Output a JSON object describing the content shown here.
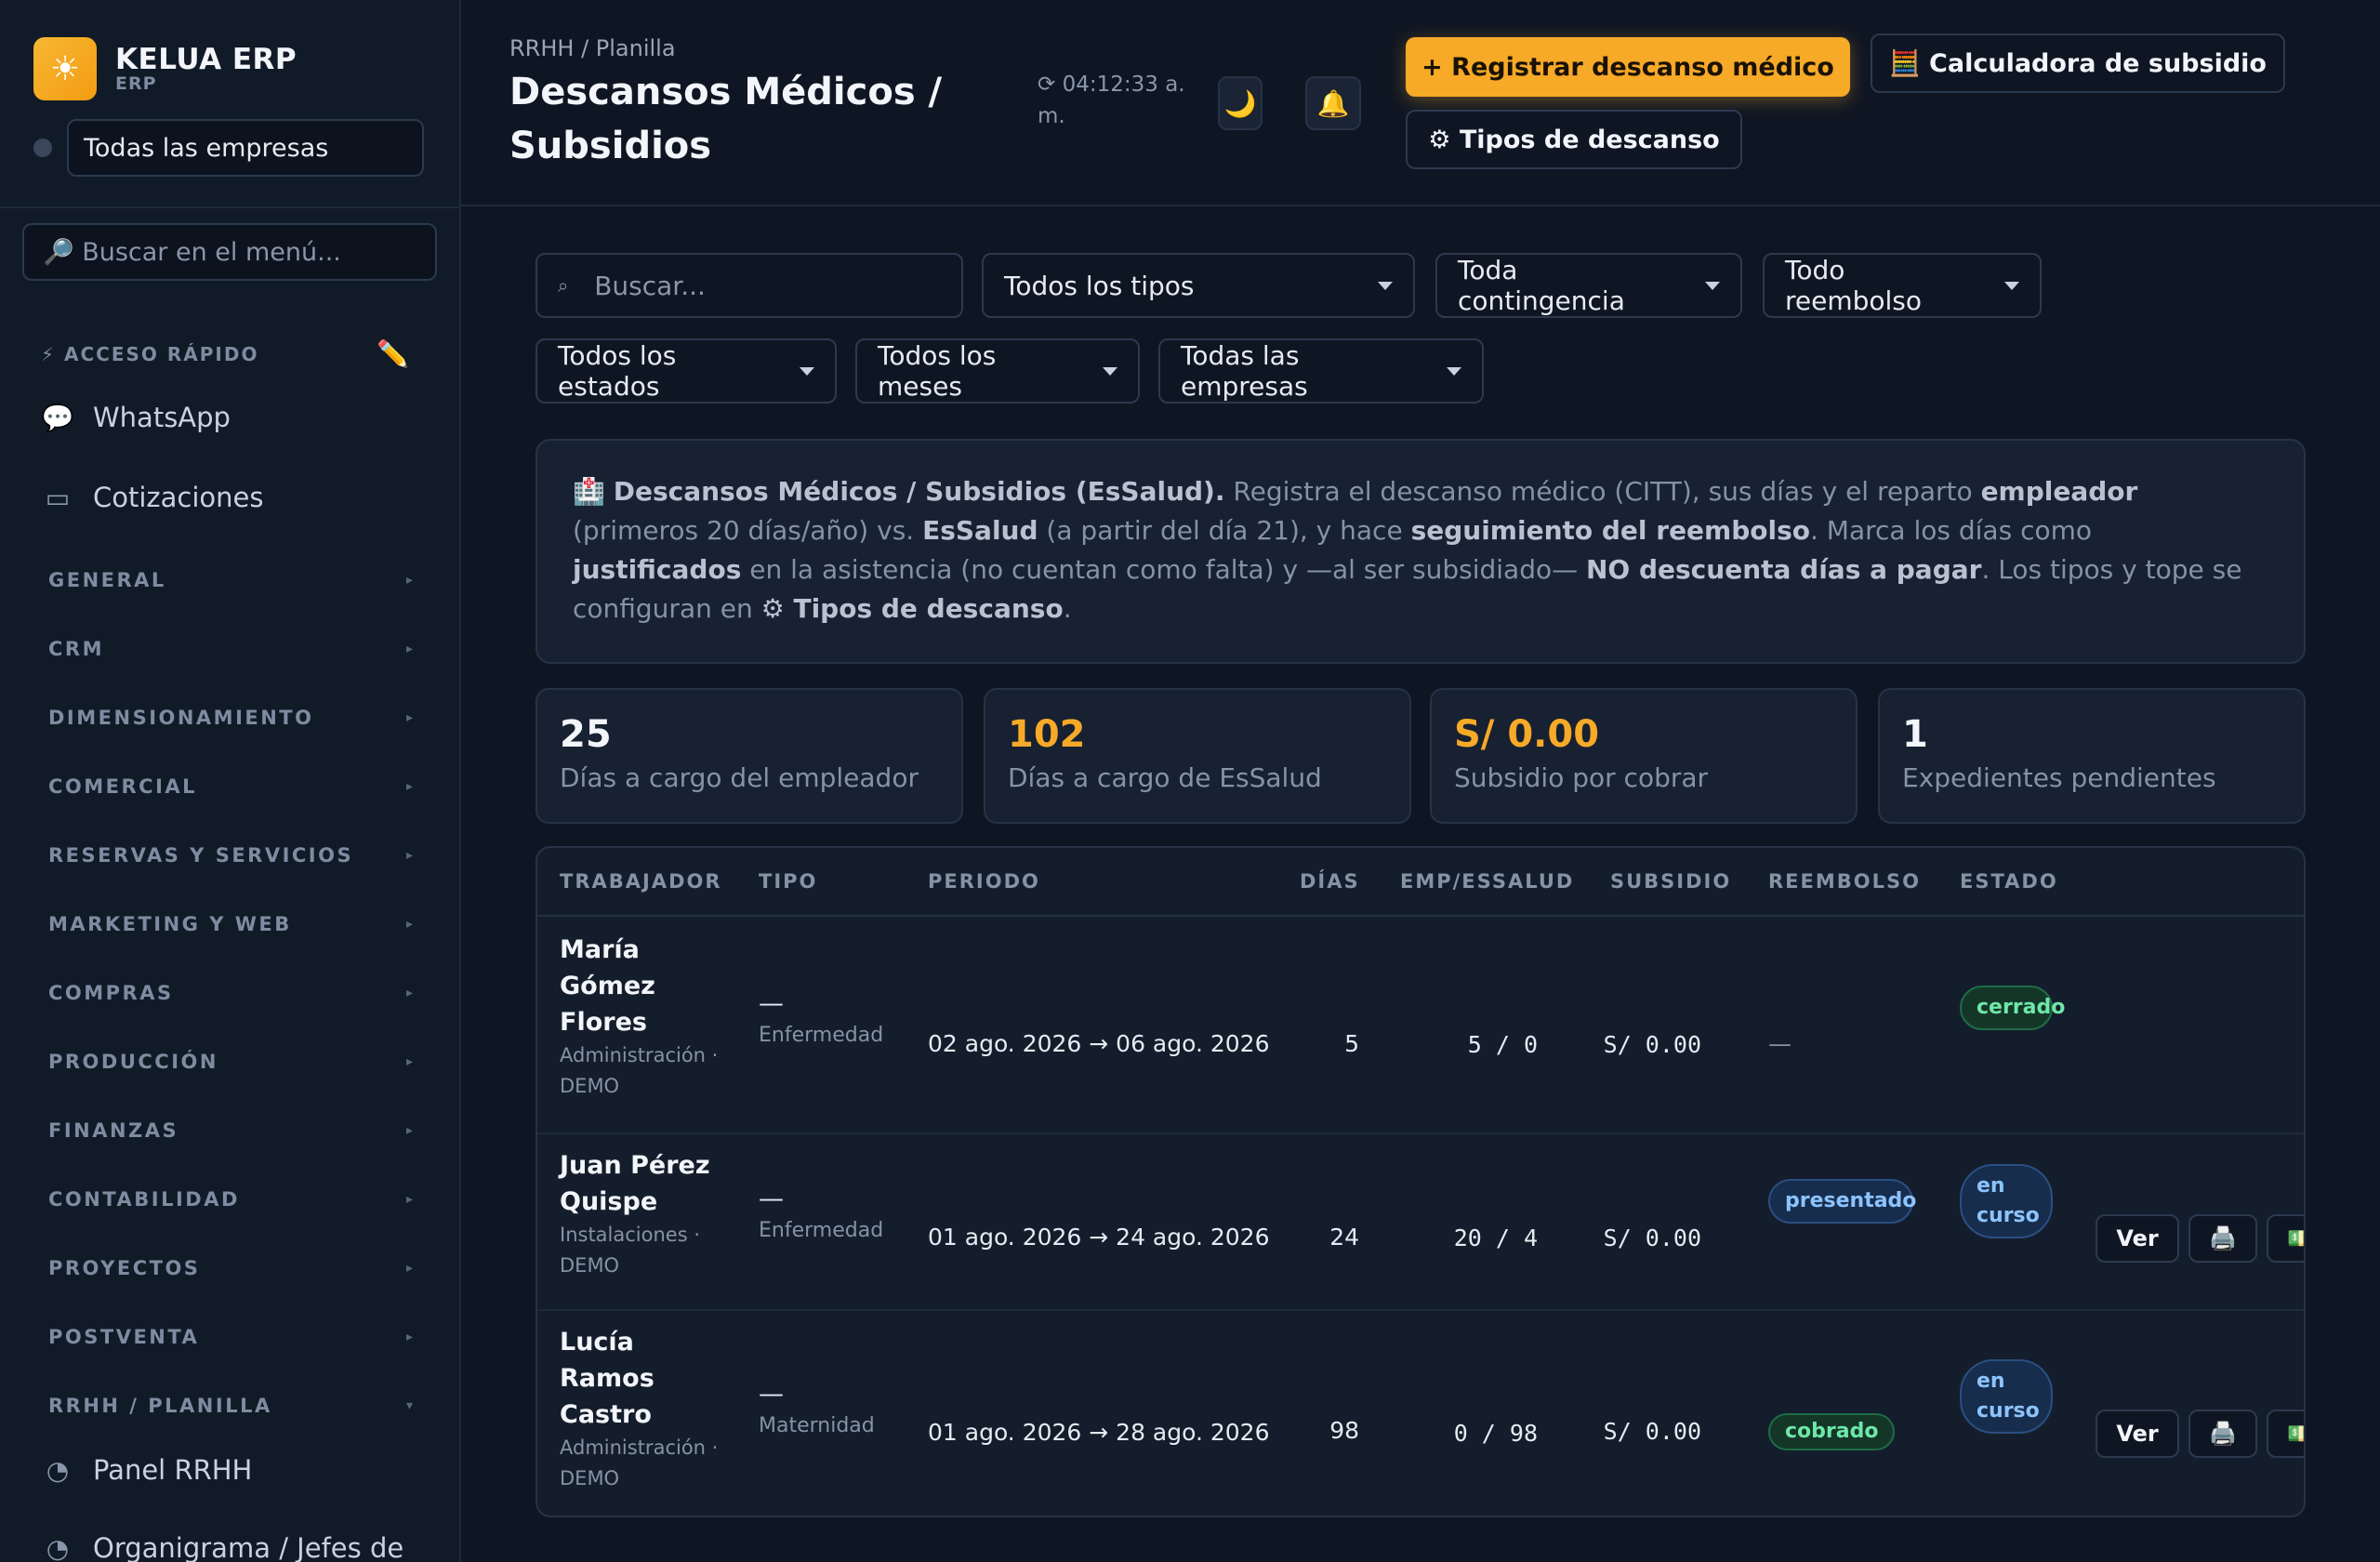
{
  "brand": {
    "name": "KELUA ERP",
    "sub": "ERP",
    "logo_icon": "sun-icon"
  },
  "sidebar": {
    "company_select": "Todas las empresas",
    "search_placeholder": "🔎 Buscar en el menú...",
    "quick_access_label": "⚡ ACCESO RÁPIDO",
    "quick_items": [
      {
        "label": "WhatsApp",
        "icon": "💬"
      },
      {
        "label": "Cotizaciones",
        "icon": "▭"
      }
    ],
    "sections": [
      "GENERAL",
      "CRM",
      "DIMENSIONAMIENTO",
      "COMERCIAL",
      "RESERVAS Y SERVICIOS",
      "MARKETING Y WEB",
      "COMPRAS",
      "PRODUCCIÓN",
      "FINANZAS",
      "CONTABILIDAD",
      "PROYECTOS",
      "POSTVENTA",
      "RRHH / PLANILLA"
    ],
    "rrhh_items": [
      {
        "label": "Panel RRHH",
        "icon": "◔"
      },
      {
        "label": "Organigrama / Jefes de",
        "icon": "◔"
      }
    ]
  },
  "header": {
    "breadcrumb": "RRHH / Planilla",
    "title": "Descansos Médicos / Subsidios",
    "clock": "⟳ 04:12:33 a. m.",
    "theme_icon": "🌙",
    "bell_icon": "🔔",
    "btn_register": "+ Registrar descanso médico",
    "btn_calculator": "🧮 Calculadora de subsidio",
    "btn_types": "⚙ Tipos de descanso"
  },
  "filters": {
    "search_placeholder": "Buscar...",
    "tipo": "Todos los tipos",
    "contingencia": "Toda contingencia",
    "reembolso": "Todo reembolso",
    "estado": "Todos los estados",
    "mes": "Todos los meses",
    "empresa": "Todas las empresas"
  },
  "info": {
    "icon": "🏥",
    "t1": "Descansos Médicos / Subsidios (EsSalud).",
    "t2": " Registra el descanso médico (CITT), sus días y el reparto ",
    "t3": "empleador",
    "t4": " (primeros 20 días/año) vs. ",
    "t5": "EsSalud",
    "t6": " (a partir del día 21), y hace ",
    "t7": "seguimiento del reembolso",
    "t8": ". Marca los días como ",
    "t9": "justificados",
    "t10": " en la asistencia (no cuentan como falta) y —al ser subsidiado— ",
    "t11": "NO descuenta días a pagar",
    "t12": ". Los tipos y tope se configuran en ",
    "t13": "⚙ Tipos de descanso",
    "t14": "."
  },
  "stats": [
    {
      "value": "25",
      "label": "Días a cargo del empleador"
    },
    {
      "value": "102",
      "label": "Días a cargo de EsSalud"
    },
    {
      "value": "S/ 0.00",
      "label": "Subsidio por cobrar"
    },
    {
      "value": "1",
      "label": "Expedientes pendientes"
    }
  ],
  "table": {
    "headers": [
      "TRABAJADOR",
      "TIPO",
      "PERIODO",
      "DÍAS",
      "EMP/ESSALUD",
      "SUBSIDIO",
      "REEMBOLSO",
      "ESTADO"
    ],
    "rows": [
      {
        "name": "María Gómez Flores",
        "area": "Administración · DEMO",
        "tipo": "—",
        "tipo_sub": "Enfermedad",
        "periodo": "02 ago. 2026 → 06 ago. 2026",
        "dias": "5",
        "split": "5 / 0",
        "subsidio": "S/ 0.00",
        "reembolso": "—",
        "estado": "cerrado"
      },
      {
        "name": "Juan Pérez Quispe",
        "area": "Instalaciones · DEMO",
        "tipo": "—",
        "tipo_sub": "Enfermedad",
        "periodo": "01 ago. 2026 → 24 ago. 2026",
        "dias": "24",
        "split": "20 / 4",
        "subsidio": "S/ 0.00",
        "reembolso": "presentado",
        "estado": "en curso",
        "btn_view": "Ver",
        "print_icon": "🖨️",
        "money_icon": "💵"
      },
      {
        "name": "Lucía Ramos Castro",
        "area": "Administración · DEMO",
        "tipo": "—",
        "tipo_sub": "Maternidad",
        "periodo": "01 ago. 2026 → 28 ago. 2026",
        "dias": "98",
        "split": "0 / 98",
        "subsidio": "S/ 0.00",
        "reembolso": "cobrado",
        "estado": "en curso",
        "btn_view": "Ver",
        "print_icon": "🖨️",
        "money_icon": "💵"
      }
    ]
  },
  "colors": {
    "accent": "#f7a928",
    "bg": "#0f1623",
    "success": "#6ee7a8",
    "info": "#8cc4ff"
  }
}
